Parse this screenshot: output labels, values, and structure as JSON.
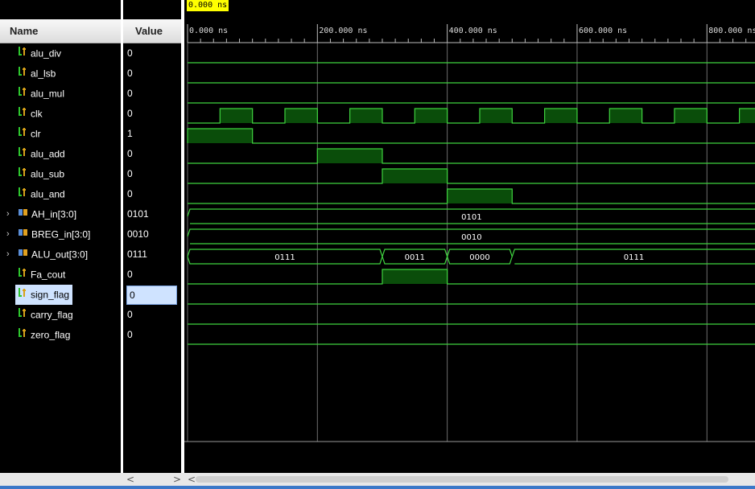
{
  "header": {
    "name_label": "Name",
    "value_label": "Value"
  },
  "cursor": {
    "label": "0.000 ns"
  },
  "time_axis": {
    "ticks": [
      "0.000 ns",
      "200.000 ns",
      "400.000 ns",
      "600.000 ns",
      "800.000 ns"
    ]
  },
  "signals": [
    {
      "name": "alu_div",
      "value": "0",
      "kind": "bit"
    },
    {
      "name": "al_lsb",
      "value": "0",
      "kind": "bit"
    },
    {
      "name": "alu_mul",
      "value": "0",
      "kind": "bit"
    },
    {
      "name": "clk",
      "value": "0",
      "kind": "bit"
    },
    {
      "name": "clr",
      "value": "1",
      "kind": "bit"
    },
    {
      "name": "alu_add",
      "value": "0",
      "kind": "bit"
    },
    {
      "name": "alu_sub",
      "value": "0",
      "kind": "bit"
    },
    {
      "name": "alu_and",
      "value": "0",
      "kind": "bit"
    },
    {
      "name": "AH_in[3:0]",
      "value": "0101",
      "kind": "bus"
    },
    {
      "name": "BREG_in[3:0]",
      "value": "0010",
      "kind": "bus"
    },
    {
      "name": "ALU_out[3:0]",
      "value": "0111",
      "kind": "bus"
    },
    {
      "name": "Fa_cout",
      "value": "0",
      "kind": "bit"
    },
    {
      "name": "sign_flag",
      "value": "0",
      "kind": "bit",
      "selected": true
    },
    {
      "name": "carry_flag",
      "value": "0",
      "kind": "bit"
    },
    {
      "name": "zero_flag",
      "value": "0",
      "kind": "bit"
    }
  ],
  "waveforms": {
    "alu_div": {
      "highs": []
    },
    "al_lsb": {
      "highs": []
    },
    "alu_mul": {
      "highs": []
    },
    "clk": {
      "highs": [
        [
          50,
          100
        ],
        [
          150,
          200
        ],
        [
          250,
          300
        ],
        [
          350,
          400
        ],
        [
          450,
          500
        ],
        [
          550,
          600
        ],
        [
          650,
          700
        ],
        [
          750,
          800
        ],
        [
          850,
          900
        ]
      ]
    },
    "clr": {
      "highs": [
        [
          0,
          100
        ]
      ]
    },
    "alu_add": {
      "highs": [
        [
          200,
          300
        ]
      ]
    },
    "alu_sub": {
      "highs": [
        [
          300,
          400
        ]
      ]
    },
    "alu_and": {
      "highs": [
        [
          400,
          500
        ]
      ]
    },
    "AH_in[3:0]": {
      "segments": [
        {
          "start": 0,
          "end": 875,
          "label": "0101"
        }
      ]
    },
    "BREG_in[3:0]": {
      "segments": [
        {
          "start": 0,
          "end": 875,
          "label": "0010"
        }
      ]
    },
    "ALU_out[3:0]": {
      "segments": [
        {
          "start": 0,
          "end": 300,
          "label": "0111"
        },
        {
          "start": 300,
          "end": 400,
          "label": "0011"
        },
        {
          "start": 400,
          "end": 500,
          "label": "0000"
        },
        {
          "start": 500,
          "end": 875,
          "label": "0111"
        }
      ]
    },
    "Fa_cout": {
      "highs": [
        [
          300,
          400
        ]
      ]
    },
    "sign_flag": {
      "highs": []
    },
    "carry_flag": {
      "highs": []
    },
    "zero_flag": {
      "highs": []
    }
  },
  "time_range_ns": [
    0,
    875
  ],
  "colors": {
    "wave": "#3fd23f",
    "fill": "#0a4d0a",
    "grid": "#c8c8c8",
    "cursor_bg": "#ffff00"
  },
  "icons": {
    "bit": "bit-signal-icon",
    "bus": "bus-signal-icon"
  },
  "scroll": {
    "left_arrow": "<",
    "right_arrow": ">"
  }
}
